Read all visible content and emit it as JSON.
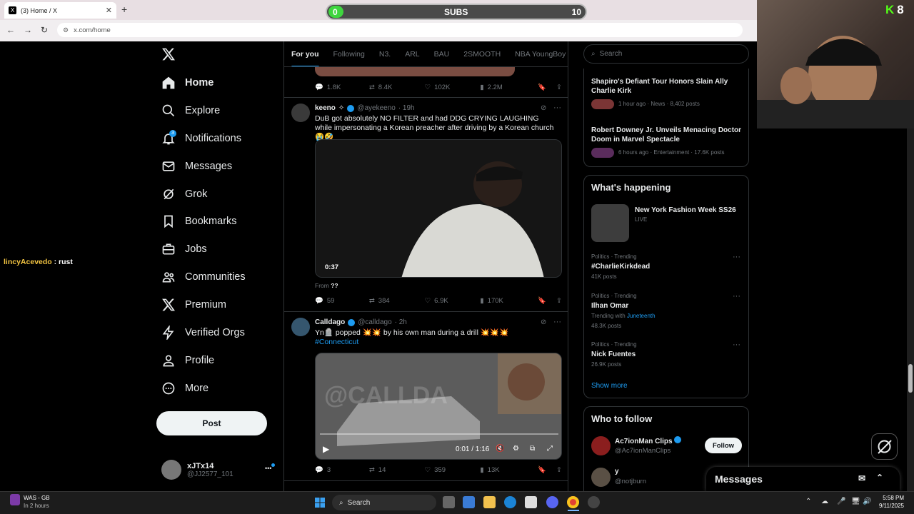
{
  "browser": {
    "tab_title": "(3) Home / X",
    "tab_favicon": "X",
    "close": "✕",
    "new_tab": "+",
    "url": "x.com/home",
    "back": "←",
    "forward": "→",
    "reload": "↻"
  },
  "overlay": {
    "subs_label": "SUBS",
    "subs_current": "0",
    "subs_goal": "10",
    "subs_progress": 0.0,
    "kick_count": "8",
    "kick_logo": "K",
    "chat_user": "lincyAcevedo",
    "chat_sep": " : ",
    "chat_msg": "rust"
  },
  "nav": {
    "items": [
      {
        "label": "Home",
        "icon": "home-icon"
      },
      {
        "label": "Explore",
        "icon": "search-icon"
      },
      {
        "label": "Notifications",
        "icon": "bell-icon",
        "badge": "3"
      },
      {
        "label": "Messages",
        "icon": "envelope-icon"
      },
      {
        "label": "Grok",
        "icon": "grok-icon"
      },
      {
        "label": "Bookmarks",
        "icon": "bookmark-icon"
      },
      {
        "label": "Jobs",
        "icon": "briefcase-icon"
      },
      {
        "label": "Communities",
        "icon": "people-icon"
      },
      {
        "label": "Premium",
        "icon": "x-logo-icon"
      },
      {
        "label": "Verified Orgs",
        "icon": "lightning-icon"
      },
      {
        "label": "Profile",
        "icon": "person-icon"
      },
      {
        "label": "More",
        "icon": "more-circle-icon"
      }
    ],
    "post": "Post",
    "account_name": "xJTx14",
    "account_handle": "@JJ2577_101",
    "account_more": "•••"
  },
  "feed": {
    "tabs": [
      "For you",
      "Following",
      "N3.",
      "ARL",
      "BAU",
      "2SMOOTH",
      "NBA YoungBoy"
    ],
    "top_actions": {
      "replies": "1.8K",
      "reposts": "8.4K",
      "likes": "102K",
      "views": "2.2M"
    },
    "tweets": [
      {
        "name": "keeno",
        "name_suffix": "✧",
        "handle": "@ayekeeno",
        "time": "· 19h",
        "text": "DuB got absolutely NO FILTER and had DDG CRYING LAUGHING while impersonating a Korean preacher after driving by a Korean church 😭🤣",
        "video_time": "0:37",
        "from_label": "From",
        "from_value": "??",
        "replies": "59",
        "reposts": "384",
        "likes": "6.9K",
        "views": "170K"
      },
      {
        "name": "Calldago",
        "handle": "@calldago",
        "time": "· 2h",
        "text": "Yn🪦 popped 💥💥 by his own man during a drill 💥💥💥",
        "hashtag": "#Connecticut",
        "video_time": "0:01 / 1:16",
        "watermark": "@CALLDA",
        "replies": "3",
        "reposts": "14",
        "likes": "359",
        "views": "13K"
      }
    ],
    "dots": "···"
  },
  "right": {
    "search_placeholder": "Search",
    "news": [
      {
        "title": "Shapiro's Defiant Tour Honors Slain Ally Charlie Kirk",
        "meta": "1 hour ago · News · 8,402 posts"
      },
      {
        "title": "Robert Downey Jr. Unveils Menacing Doctor Doom in Marvel Spectacle",
        "meta": "6 hours ago · Entertainment · 17.6K posts"
      }
    ],
    "happening_title": "What's happening",
    "event": {
      "title": "New York Fashion Week SS26",
      "status": "LIVE"
    },
    "trends": [
      {
        "context": "Politics · Trending",
        "name": "#CharlieKirkdead",
        "posts": "41K posts"
      },
      {
        "context": "Politics · Trending",
        "name": "Ilhan Omar",
        "with_label": "Trending with",
        "with_tag": "Juneteenth",
        "posts": "48.3K posts"
      },
      {
        "context": "Politics · Trending",
        "name": "Nick Fuentes",
        "posts": "26.9K posts"
      }
    ],
    "show_more": "Show more",
    "who_title": "Who to follow",
    "follow": [
      {
        "name": "Ac7ionMan Clips",
        "handle": "@Ac7ionManClips",
        "button": "Follow"
      },
      {
        "name": "y",
        "handle": "@notjburn"
      }
    ]
  },
  "messages_bar": {
    "title": "Messages"
  },
  "taskbar": {
    "weather_title": "WAS - GB",
    "weather_sub": "In 2 hours",
    "search": "Search",
    "time": "5:58 PM",
    "date": "9/11/2025"
  },
  "colors": {
    "accent": "#1d9bf0",
    "subs_fill": "#3fd63f",
    "kick": "#53fc18"
  }
}
